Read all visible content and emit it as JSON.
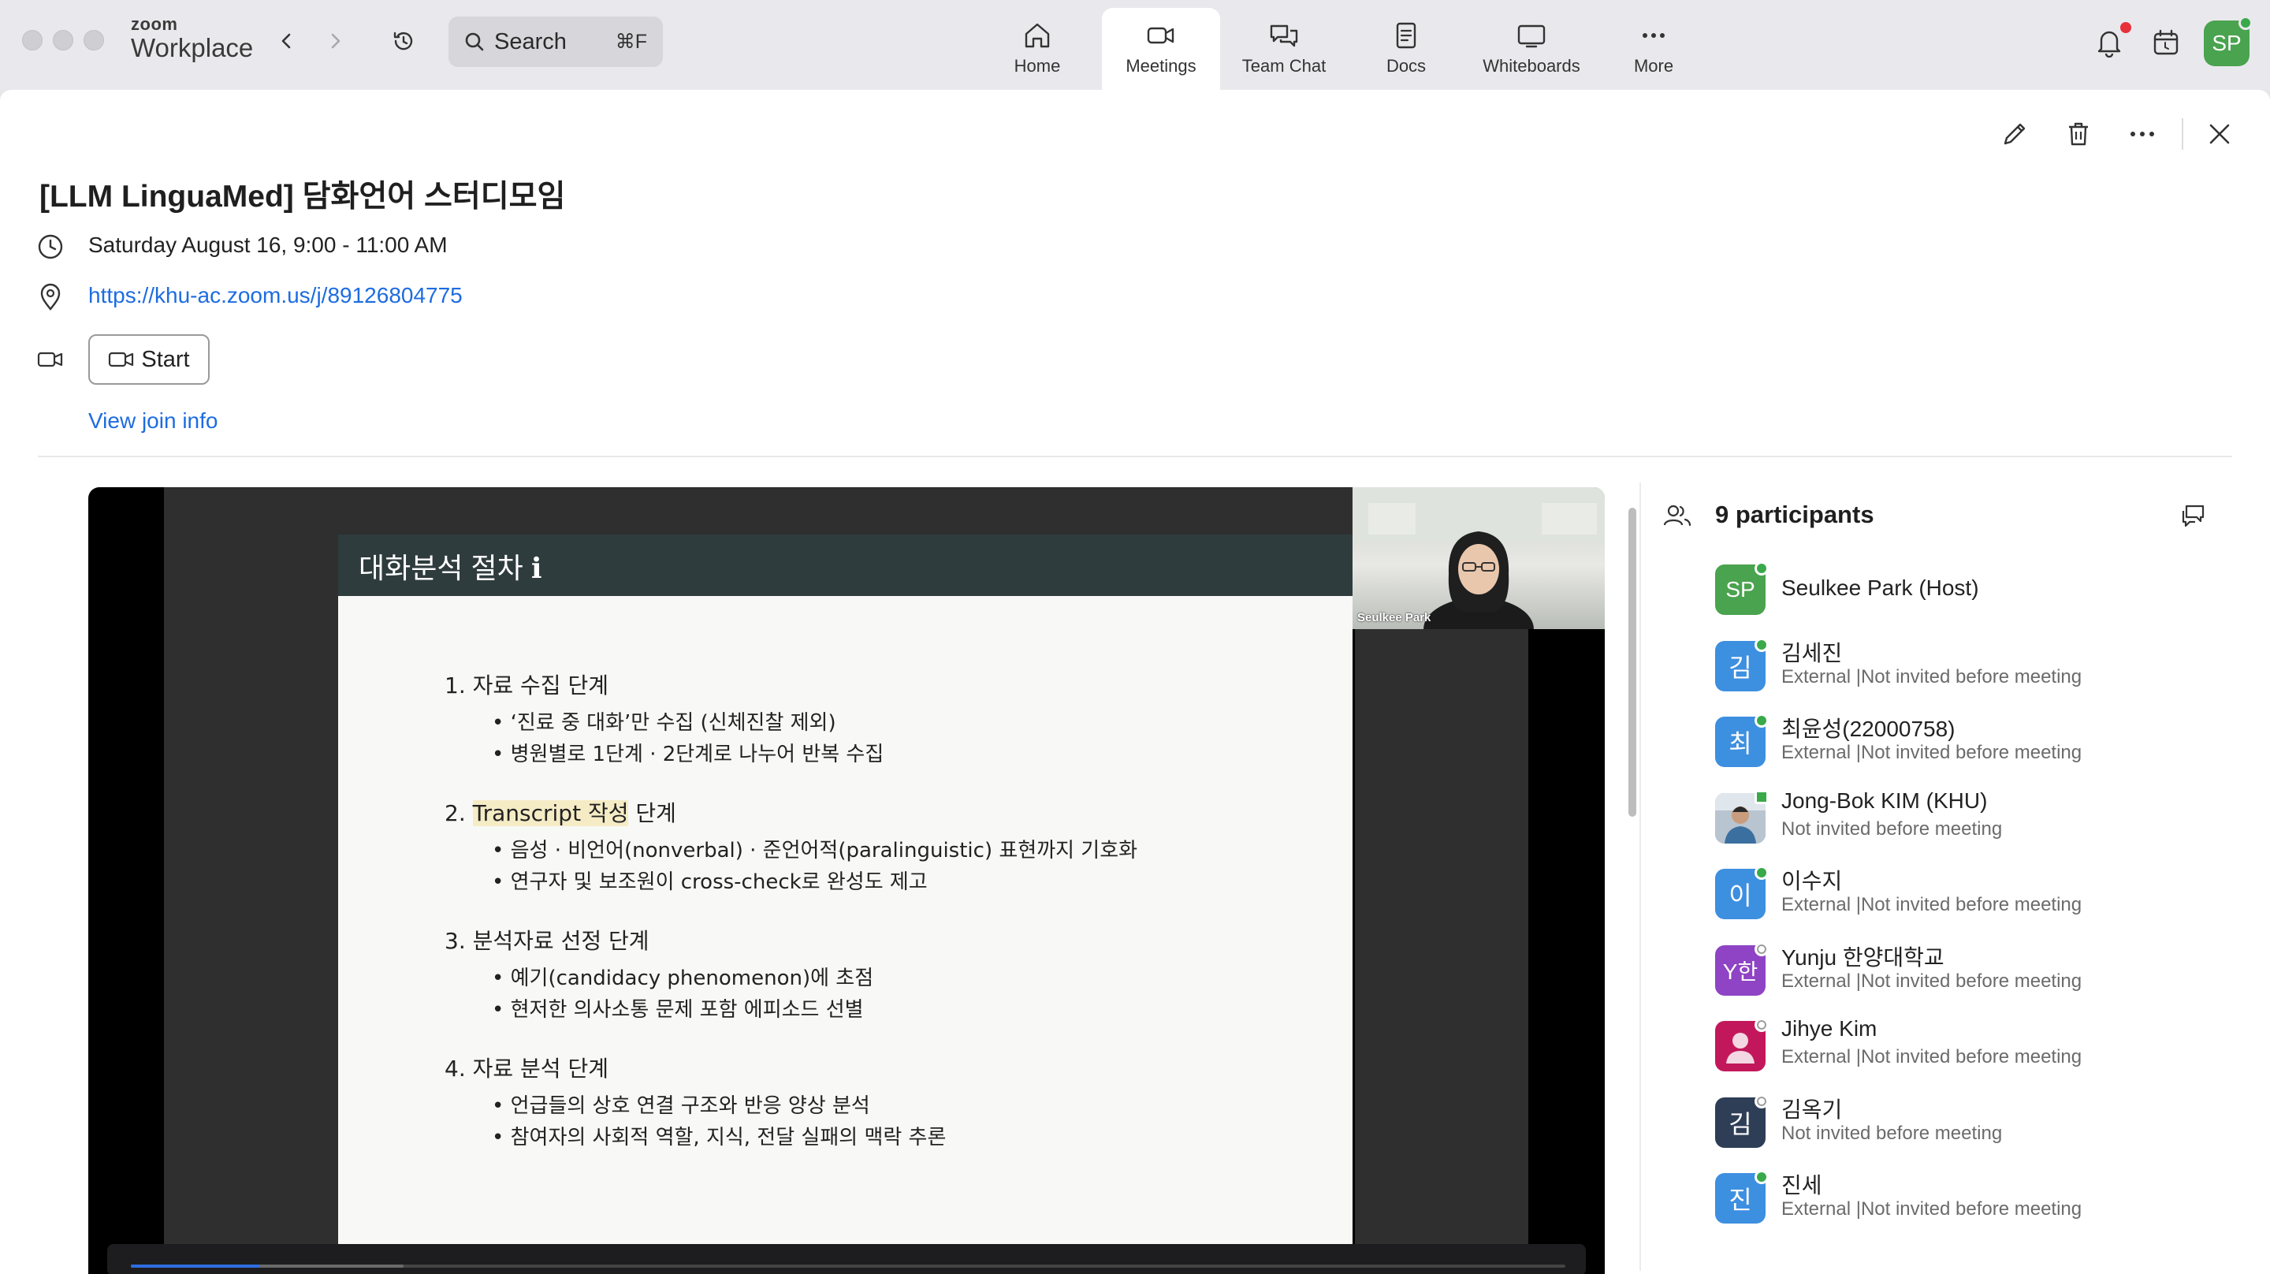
{
  "app": {
    "brand_small": "zoom",
    "brand_big": "Workplace",
    "search_label": "Search",
    "search_shortcut": "⌘F",
    "user_initials": "SP",
    "tabs": [
      {
        "label": "Home",
        "icon": "home-icon"
      },
      {
        "label": "Meetings",
        "icon": "video-camera-icon"
      },
      {
        "label": "Team Chat",
        "icon": "chat-bubbles-icon"
      },
      {
        "label": "Docs",
        "icon": "document-icon"
      },
      {
        "label": "Whiteboards",
        "icon": "whiteboard-icon"
      },
      {
        "label": "More",
        "icon": "more-dots-icon"
      }
    ],
    "active_tab": "Meetings",
    "colors": {
      "accent": "#1d6ce0",
      "online": "#3aa94a",
      "notification": "#e8303a"
    }
  },
  "meeting": {
    "title": "[LLM LinguaMed] 담화언어 스터디모임",
    "time": "Saturday August 16, 9:00 - 11:00 AM",
    "link": "https://khu-ac.zoom.us/j/89126804775",
    "start_label": "Start",
    "join_info_label": "View join info"
  },
  "video": {
    "camera_name": "Seulkee Park",
    "progress": 0.09,
    "buffered": 0.19,
    "slide": {
      "title": "대화분석 절차 ℹ",
      "items": [
        {
          "num": "1.",
          "text": "자료 수집 단계",
          "subs": [
            "• ‘진료 중 대화’만 수집 (신체진찰 제외)",
            "• 병원별로 1단계 · 2단계로 나누어 반복 수집"
          ]
        },
        {
          "num": "2.",
          "text_hl": "Transcript 작성",
          "text": " 단계",
          "subs": [
            "• 음성 · 비언어(nonverbal) · 준언어적(paralinguistic) 표현까지 기호화",
            "• 연구자 및 보조원이 cross-check로 완성도 제고"
          ]
        },
        {
          "num": "3.",
          "text": "분석자료 선정 단계",
          "subs": [
            "• 예기(candidacy phenomenon)에 초점",
            "• 현저한 의사소통 문제 포함 에피소드 선별"
          ]
        },
        {
          "num": "4.",
          "text": "자료 분석 단계",
          "subs": [
            "• 언급들의 상호 연결 구조와 반응 양상 분석",
            "• 참여자의 사회적 역할, 지식, 전달 실패의 맥락 추론"
          ]
        }
      ]
    }
  },
  "participants": {
    "title": "9 participants",
    "list": [
      {
        "initials": "SP",
        "name": "Seulkee Park (Host)",
        "sub": "",
        "color": "#4aa34e",
        "status": "online"
      },
      {
        "initials": "김",
        "name": "김세진",
        "sub": "External |Not invited before meeting",
        "color": "#3d8fe0",
        "status": "online"
      },
      {
        "initials": "최",
        "name": "최윤성(22000758)",
        "sub": "External |Not invited before meeting",
        "color": "#3d8fe0",
        "status": "online"
      },
      {
        "initials": "",
        "name": "Jong-Bok KIM (KHU)",
        "sub": "Not invited before meeting",
        "color": "#7a8fa6",
        "status": "mobile",
        "photo": true
      },
      {
        "initials": "이",
        "name": "이수지",
        "sub": "External |Not invited before meeting",
        "color": "#3d8fe0",
        "status": "online"
      },
      {
        "initials": "Y한",
        "name": "Yunju 한양대학교",
        "sub": "External |Not invited before meeting",
        "color": "#8e44c4",
        "status": "offline"
      },
      {
        "initials": "",
        "name": "Jihye Kim",
        "sub": "External |Not invited before meeting",
        "color": "#c2185b",
        "status": "away",
        "avatar_icon": "person-silhouette-icon"
      },
      {
        "initials": "김",
        "name": "김옥기",
        "sub": "Not invited before meeting",
        "color": "#2f3e57",
        "status": "offline"
      },
      {
        "initials": "진",
        "name": "진세",
        "sub": "External |Not invited before meeting",
        "color": "#3d8fe0",
        "status": "online"
      }
    ]
  }
}
